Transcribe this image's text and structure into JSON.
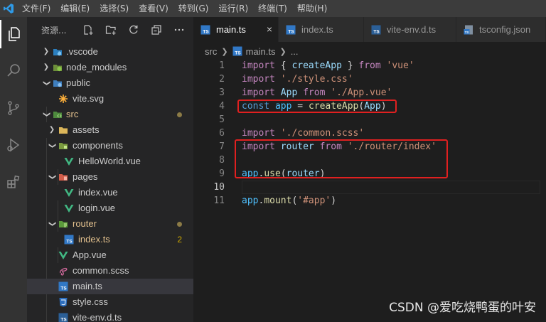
{
  "menubar": {
    "items": [
      "文件(F)",
      "编辑(E)",
      "选择(S)",
      "查看(V)",
      "转到(G)",
      "运行(R)",
      "终端(T)",
      "帮助(H)"
    ]
  },
  "activity": {
    "icons": [
      "explorer-icon",
      "search-icon",
      "source-control-icon",
      "run-debug-icon",
      "extensions-icon"
    ]
  },
  "sidebar": {
    "title": "资源...",
    "actions": [
      "new-file-icon",
      "new-folder-icon",
      "refresh-icon",
      "collapse-icon",
      "more-icon"
    ],
    "tree": [
      {
        "label": ".vscode",
        "type": "folder"
      },
      {
        "label": "node_modules",
        "type": "folder"
      },
      {
        "label": "public",
        "type": "folder-open"
      },
      {
        "label": "vite.svg",
        "type": "svg"
      },
      {
        "label": "src",
        "type": "folder-open"
      },
      {
        "label": "assets",
        "type": "folder"
      },
      {
        "label": "components",
        "type": "folder-open"
      },
      {
        "label": "HelloWorld.vue",
        "type": "vue"
      },
      {
        "label": "pages",
        "type": "folder-open"
      },
      {
        "label": "index.vue",
        "type": "vue"
      },
      {
        "label": "login.vue",
        "type": "vue"
      },
      {
        "label": "router",
        "type": "folder-open"
      },
      {
        "label": "index.ts",
        "type": "ts",
        "problems": "2"
      },
      {
        "label": "App.vue",
        "type": "vue"
      },
      {
        "label": "common.scss",
        "type": "scss"
      },
      {
        "label": "main.ts",
        "type": "ts"
      },
      {
        "label": "style.css",
        "type": "css"
      },
      {
        "label": "vite-env.d.ts",
        "type": "ts"
      }
    ]
  },
  "tabs": [
    {
      "label": "main.ts",
      "close": "×"
    },
    {
      "label": "index.ts"
    },
    {
      "label": "vite-env.d.ts"
    },
    {
      "label": "tsconfig.json"
    }
  ],
  "breadcrumb": {
    "folder": "src",
    "file": "main.ts",
    "more": "..."
  },
  "editor": {
    "line_numbers": [
      "1",
      "2",
      "3",
      "4",
      "5",
      "6",
      "7",
      "8",
      "9",
      "10",
      "11"
    ],
    "lines": [
      [
        "import",
        " { ",
        "createApp",
        " } ",
        "from",
        " ",
        "'vue'"
      ],
      [
        "import",
        " ",
        "'./style.css'"
      ],
      [
        "import",
        " ",
        "App",
        " ",
        "from",
        " ",
        "'./App.vue'"
      ],
      [
        "const",
        " ",
        "app",
        " = ",
        "createApp",
        "(",
        "App",
        ")"
      ],
      [],
      [
        "import",
        " ",
        "'./common.scss'"
      ],
      [
        "import",
        " ",
        "router",
        " ",
        "from",
        " ",
        "'./router/index'"
      ],
      [],
      [
        "app",
        ".",
        "use",
        "(",
        "router",
        ")"
      ],
      [],
      [
        "app",
        ".",
        "mount",
        "(",
        "'#app'",
        ")"
      ]
    ]
  },
  "watermark": "CSDN @爱吃烧鸭蛋的叶安",
  "colors": {
    "highlight_box": "#e02020",
    "keyword": "#569cd6",
    "import_keyword": "#c586c0",
    "string": "#ce9178",
    "function": "#dcdcaa",
    "variable": "#9cdcfe"
  }
}
